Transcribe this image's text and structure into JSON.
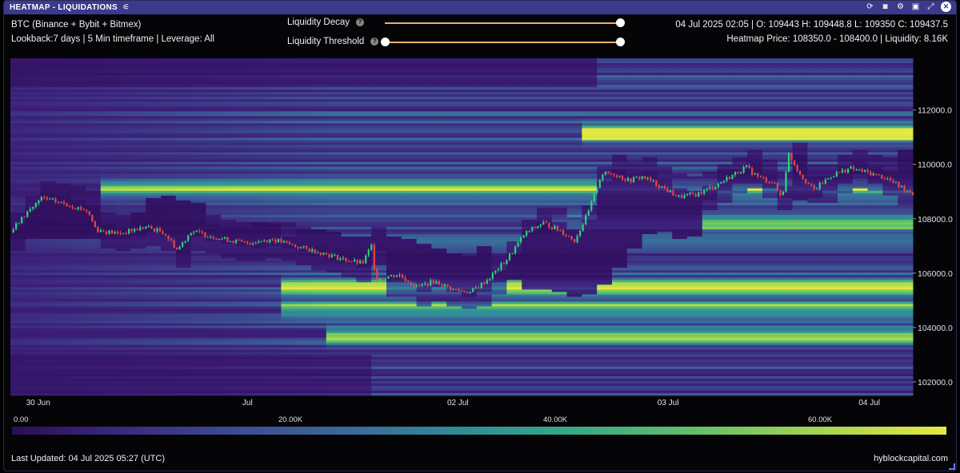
{
  "window": {
    "title": "HEATMAP - LIQUIDATIONS"
  },
  "header": {
    "left_line1": "BTC (Binance + Bybit + Bitmex)",
    "left_line2": "Lookback:7 days | 5 Min timeframe | Leverage: All",
    "right_line1": "04 Jul 2025 02:05 | O: 109443 H: 109448.8 L: 109350 C: 109437.5",
    "right_line2": "Heatmap Price: 108350.0 - 108400.0 | Liquidity: 8.16K"
  },
  "controls": {
    "decay_label": "Liquidity Decay",
    "threshold_label": "Liquidity Threshold",
    "decay_value": 1.0,
    "threshold_range": [
      0.0,
      1.0
    ]
  },
  "colors": {
    "accent": "#3b3a8c",
    "candle_up": "#2bd47a",
    "candle_down": "#e8473e",
    "slider": "#e9b06a"
  },
  "chart_data": {
    "type": "heatmap",
    "x_ticks": [
      "30 Jun",
      "Jul",
      "02 Jul",
      "03 Jul",
      "04 Jul"
    ],
    "y_ticks": [
      "112000.0",
      "110000.0",
      "108000.0",
      "106000.0",
      "104000.0",
      "102000.0"
    ],
    "ylim": [
      101500,
      113900
    ],
    "price_path": [
      [
        0,
        107500
      ],
      [
        0.02,
        108300
      ],
      [
        0.035,
        108750
      ],
      [
        0.06,
        108550
      ],
      [
        0.085,
        108300
      ],
      [
        0.095,
        107600
      ],
      [
        0.12,
        107450
      ],
      [
        0.15,
        107700
      ],
      [
        0.17,
        107500
      ],
      [
        0.185,
        106850
      ],
      [
        0.2,
        107550
      ],
      [
        0.23,
        107300
      ],
      [
        0.26,
        107100
      ],
      [
        0.29,
        107250
      ],
      [
        0.32,
        106950
      ],
      [
        0.345,
        106750
      ],
      [
        0.37,
        106500
      ],
      [
        0.39,
        106350
      ],
      [
        0.4,
        107000
      ],
      [
        0.405,
        105800
      ],
      [
        0.43,
        105950
      ],
      [
        0.45,
        105500
      ],
      [
        0.47,
        105700
      ],
      [
        0.49,
        105400
      ],
      [
        0.51,
        105300
      ],
      [
        0.53,
        105800
      ],
      [
        0.55,
        106500
      ],
      [
        0.57,
        107450
      ],
      [
        0.59,
        107850
      ],
      [
        0.61,
        107550
      ],
      [
        0.625,
        107200
      ],
      [
        0.64,
        108200
      ],
      [
        0.648,
        109000
      ],
      [
        0.655,
        109650
      ],
      [
        0.67,
        109650
      ],
      [
        0.685,
        109400
      ],
      [
        0.7,
        109550
      ],
      [
        0.72,
        109200
      ],
      [
        0.74,
        108800
      ],
      [
        0.76,
        108900
      ],
      [
        0.78,
        109200
      ],
      [
        0.8,
        109600
      ],
      [
        0.815,
        109900
      ],
      [
        0.83,
        109500
      ],
      [
        0.845,
        109350
      ],
      [
        0.855,
        108750
      ],
      [
        0.862,
        110400
      ],
      [
        0.875,
        109650
      ],
      [
        0.89,
        109050
      ],
      [
        0.91,
        109600
      ],
      [
        0.93,
        109850
      ],
      [
        0.95,
        109700
      ],
      [
        0.97,
        109500
      ],
      [
        0.985,
        109200
      ],
      [
        1.0,
        108950
      ]
    ],
    "colorbar": {
      "ticks": [
        "0.00",
        "20.00K",
        "40.00K",
        "60.00K"
      ],
      "max": 68000
    }
  },
  "footer": {
    "last_updated": "Last Updated: 04 Jul 2025 05:27 (UTC)",
    "brand": "hyblockcapital.com"
  }
}
